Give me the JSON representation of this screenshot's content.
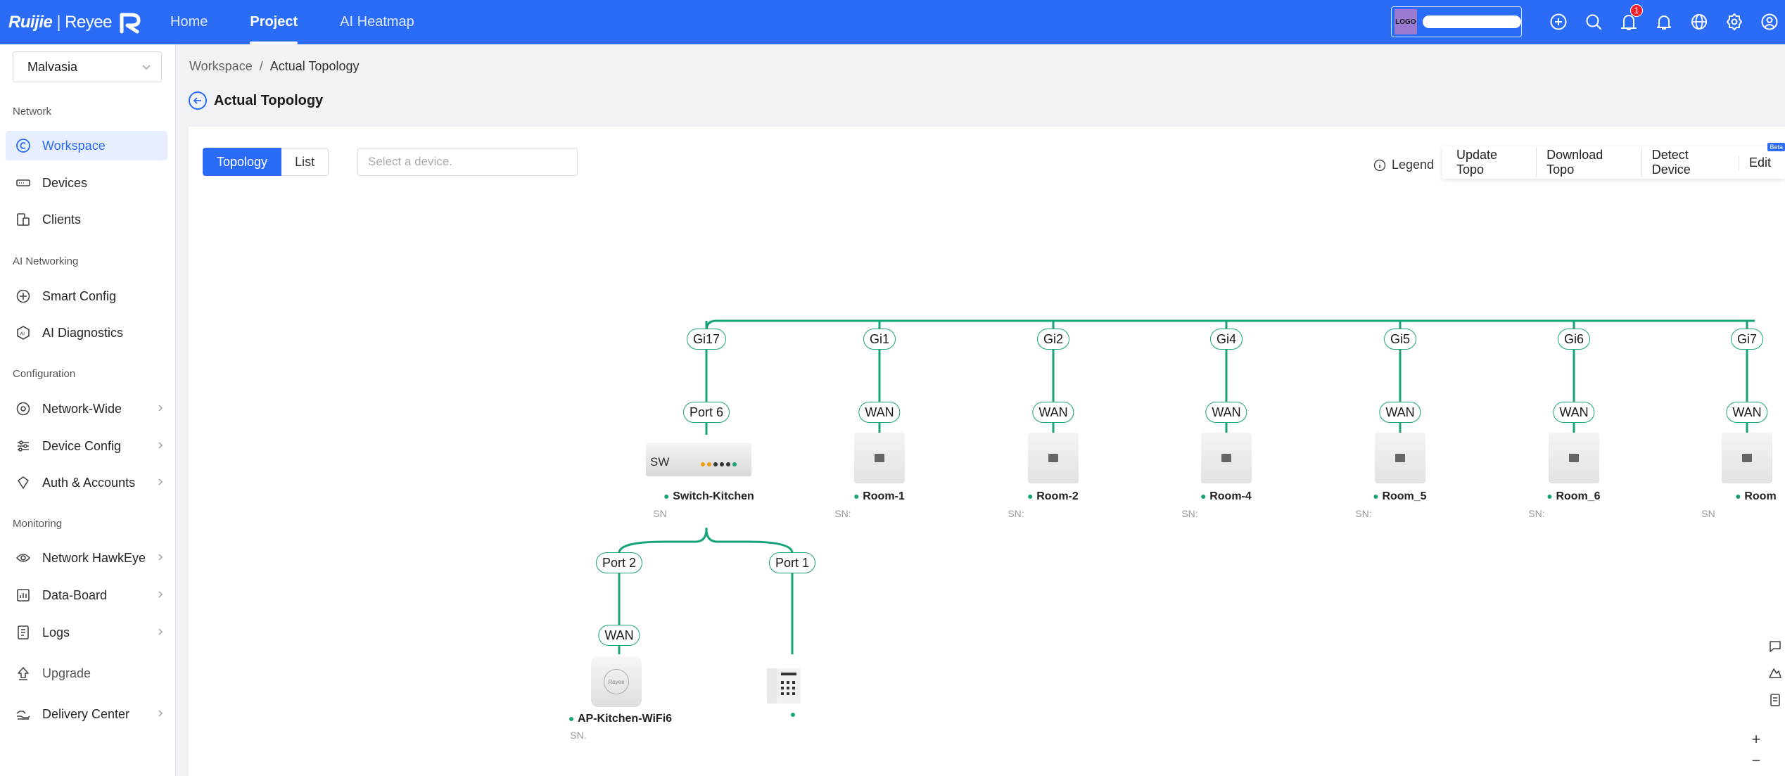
{
  "brand": {
    "ruijie": "Ruijie",
    "reyee": "Reyee"
  },
  "nav": [
    {
      "label": "Home"
    },
    {
      "label": "Project"
    },
    {
      "label": "AI Heatmap"
    }
  ],
  "account": {
    "logo_text": "LOGO"
  },
  "notifications": {
    "count": "1"
  },
  "sidebar": {
    "site": "Malvasia",
    "sections": {
      "network": "Network",
      "ai": "AI Networking",
      "config": "Configuration",
      "monitoring": "Monitoring"
    },
    "items": {
      "workspace": "Workspace",
      "devices": "Devices",
      "clients": "Clients",
      "smart_config": "Smart Config",
      "ai_diagnostics": "AI Diagnostics",
      "network_wide": "Network-Wide",
      "device_config": "Device Config",
      "auth_accounts": "Auth & Accounts",
      "hawkeye": "Network HawkEye",
      "data_board": "Data-Board",
      "logs": "Logs",
      "upgrade": "Upgrade",
      "delivery": "Delivery Center"
    }
  },
  "breadcrumb": {
    "root": "Workspace",
    "sep": "/",
    "current": "Actual Topology"
  },
  "page": {
    "title": "Actual Topology"
  },
  "toolbar": {
    "view_topology": "Topology",
    "view_list": "List",
    "device_placeholder": "Select a device.",
    "legend": "Legend",
    "update_topo": "Update Topo",
    "download_topo": "Download Topo",
    "detect_device": "Detect Device",
    "edit": "Edit",
    "beta": "Beta"
  },
  "topology": {
    "top_nodes": [
      {
        "uplink": "Gi17",
        "downlink": "Port 6",
        "name": "Switch-Kitchen",
        "sn": "SN",
        "kind": "switch"
      },
      {
        "uplink": "Gi1",
        "downlink": "WAN",
        "name": "Room-1",
        "sn": "SN:",
        "kind": "ap"
      },
      {
        "uplink": "Gi2",
        "downlink": "WAN",
        "name": "Room-2",
        "sn": "SN:",
        "kind": "ap"
      },
      {
        "uplink": "Gi4",
        "downlink": "WAN",
        "name": "Room-4",
        "sn": "SN:",
        "kind": "ap"
      },
      {
        "uplink": "Gi5",
        "downlink": "WAN",
        "name": "Room_5",
        "sn": "SN:",
        "kind": "ap"
      },
      {
        "uplink": "Gi6",
        "downlink": "WAN",
        "name": "Room_6",
        "sn": "SN:",
        "kind": "ap"
      },
      {
        "uplink": "Gi7",
        "downlink": "WAN",
        "name": "Room",
        "sn": "SN",
        "kind": "ap"
      }
    ],
    "switch_label": "SW",
    "child_nodes": [
      {
        "uplink": "Port 2",
        "downlink": "WAN",
        "name": "AP-Kitchen-WiFi6",
        "sn": "SN.",
        "kind": "ceiling-ap",
        "ap_brand": "Reyee"
      },
      {
        "uplink": "Port 1",
        "downlink": "",
        "name": "",
        "sn": "",
        "kind": "phone"
      }
    ]
  },
  "zoom": {
    "in": "+",
    "out": "−"
  },
  "colors": {
    "accent": "#2b6cf6",
    "link": "#16a37a"
  }
}
